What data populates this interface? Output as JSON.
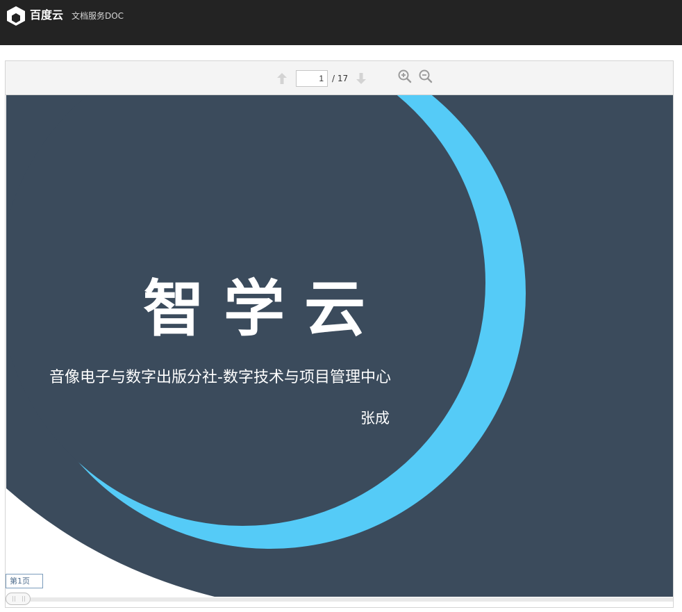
{
  "header": {
    "brand_name": "百度云",
    "service_name": "文档服务DOC",
    "logo_icon": "baidu-cloud-hexagon-icon"
  },
  "toolbar": {
    "prev_icon": "arrow-up-icon",
    "next_icon": "arrow-down-icon",
    "current_page": "1",
    "page_total": "/ 17",
    "zoom_in_icon": "zoom-in-icon",
    "zoom_out_icon": "zoom-out-icon"
  },
  "slide": {
    "title": "智学云",
    "subtitle": "音像电子与数字出版分社-数字技术与项目管理中心",
    "author": "张成",
    "colors": {
      "background": "#3b4b5c",
      "accent_ring": "#55cbf7",
      "title_text": "#ffffff"
    }
  },
  "pager": {
    "tooltip": "第1页"
  }
}
